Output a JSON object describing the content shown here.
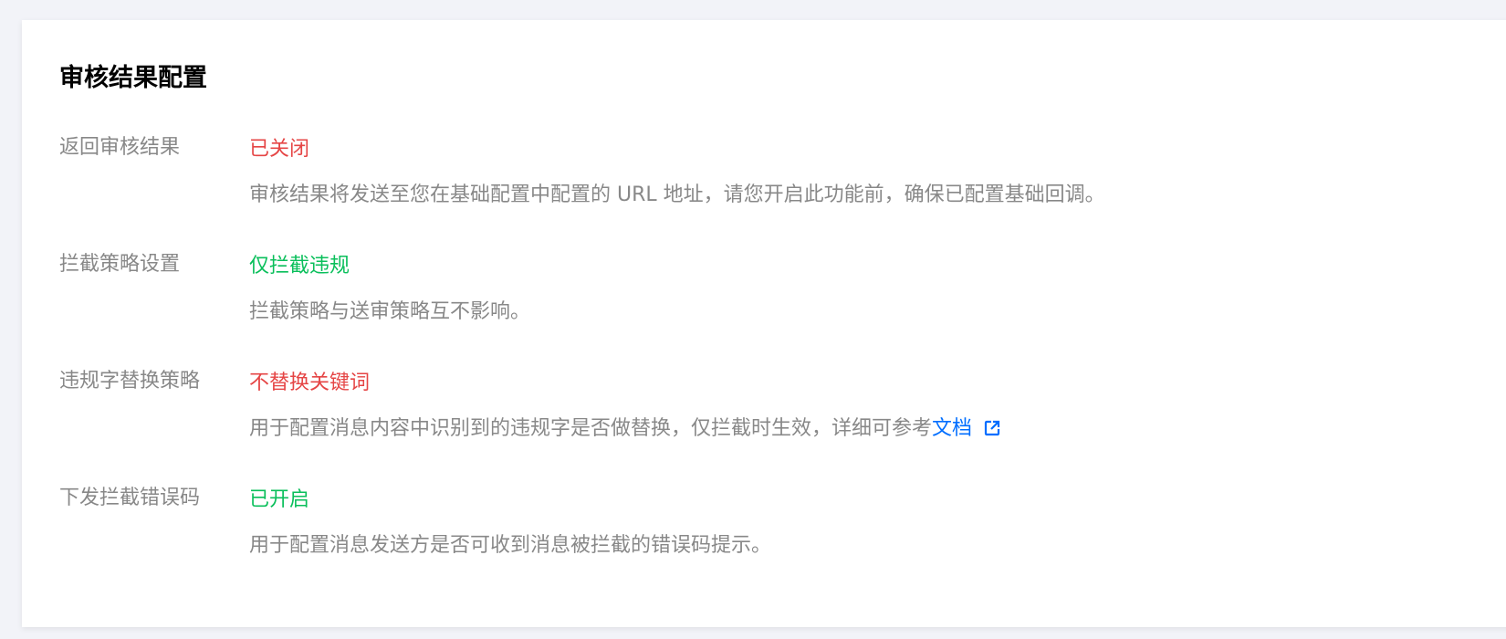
{
  "card": {
    "title": "审核结果配置"
  },
  "colors": {
    "off": "#e54545",
    "on": "#0abf5b",
    "link": "#006eff",
    "label": "#888888"
  },
  "settings": [
    {
      "label": "返回审核结果",
      "value": "已关闭",
      "status": "off",
      "description": "审核结果将发送至您在基础配置中配置的 URL 地址，请您开启此功能前，确保已配置基础回调。"
    },
    {
      "label": "拦截策略设置",
      "value": "仅拦截违规",
      "status": "on",
      "description": "拦截策略与送审策略互不影响。"
    },
    {
      "label": "违规字替换策略",
      "value": "不替换关键词",
      "status": "off",
      "description": "用于配置消息内容中识别到的违规字是否做替换，仅拦截时生效，详细可参考",
      "link_text": "文档",
      "link_icon": "external-link-icon"
    },
    {
      "label": "下发拦截错误码",
      "value": "已开启",
      "status": "on",
      "description": "用于配置消息发送方是否可收到消息被拦截的错误码提示。"
    }
  ]
}
